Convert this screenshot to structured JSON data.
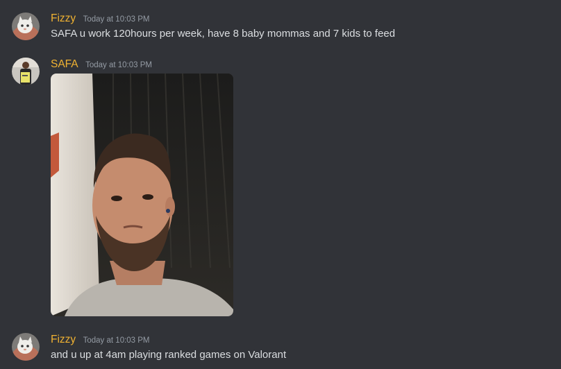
{
  "messages": [
    {
      "author": "Fizzy",
      "timestamp": "Today at 10:03 PM",
      "content": "SAFA u work 120hours per week, have 8 baby mommas and 7 kids to feed",
      "avatar_icon": "cat-avatar"
    },
    {
      "author": "SAFA",
      "timestamp": "Today at 10:03 PM",
      "content": "",
      "avatar_icon": "person-avatar",
      "attachment": "photo-selfie"
    },
    {
      "author": "Fizzy",
      "timestamp": "Today at 10:03 PM",
      "content": "and u up at 4am playing ranked games on Valorant",
      "avatar_icon": "cat-avatar"
    }
  ],
  "colors": {
    "background": "#313338",
    "author_name": "#f0b232",
    "timestamp": "#949ba4",
    "message_text": "#dbdee1"
  }
}
